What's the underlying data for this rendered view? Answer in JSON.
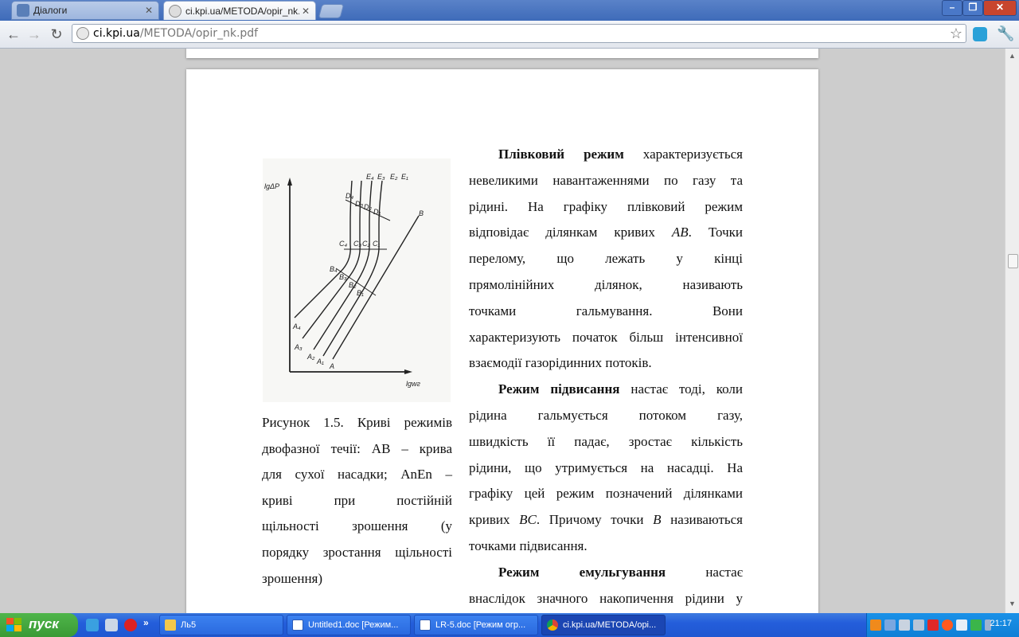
{
  "browser": {
    "tabs": [
      {
        "title": "Діалоги",
        "active": false
      },
      {
        "title": "ci.kpi.ua/METODA/opir_nk.pdf",
        "active": true
      }
    ],
    "url_host": "ci.kpi.ua",
    "url_path": "/METODA/opir_nk.pdf"
  },
  "figure": {
    "y_axis_label": "lgΔP",
    "x_axis_label": "lgwг",
    "labels": {
      "E4": "E₄",
      "E3": "E₃",
      "E2": "E₂",
      "E1": "E₁",
      "D4": "D₄",
      "D3": "D₃",
      "D2": "D₂",
      "D1": "D₁",
      "C4": "C₄",
      "C3": "C₃",
      "C2": "C₂",
      "C1": "C₁",
      "B4": "B₄",
      "B3": "B₃",
      "B2": "B₂",
      "B1": "B₁",
      "A4": "A₄",
      "A3": "A₃",
      "A2": "A₂",
      "A1": "A₁",
      "A": "A",
      "B": "B"
    }
  },
  "caption": [
    "Рисунок 1.5. Криві режимів",
    "двофазної течії: AB – крива",
    "для сухої насадки; AnEn –",
    "криві при постійній",
    "щільності зрошення (у",
    "порядку зростання щільності",
    "зрошення)"
  ],
  "text": {
    "p1_bold": "Плівковий режим",
    "p1_l1": " характеризується",
    "p1_l2": "невеликими навантаженнями по газу та",
    "p1_l3": "рідині. На графіку плівковий режим",
    "p1_l4a": "відповідає ділянкам кривих ",
    "p1_l4i": "AB",
    "p1_l4b": ". Точки",
    "p1_l5": "перелому, що лежать у кінці",
    "p1_l6": "прямолінійних ділянок, називають",
    "p1_l7": "точками гальмування. Вони",
    "p1_l8": "характеризують початок більш інтенсивної",
    "p1_l9": "взаємодії газорідинних потоків.",
    "p2_bold": "Режим підвисання",
    "p2_l1": " настає тоді, коли",
    "p2_l2": "рідина гальмується потоком газу,",
    "p2_l3": "швидкість її падає, зростає кількість",
    "p2_l4": "рідини, що утримується на насадці. На",
    "p2_l5": "графіку цей режим позначений ділянками",
    "p2_l6a": "кривих ",
    "p2_l6i": "BC",
    "p2_l6b": ". Причому точки ",
    "p2_l6i2": "B",
    "p2_l6c": " називаються",
    "p2_l7": "точками підвисання.",
    "p3_bold": "Режим емульгування",
    "p3_l1": " настає",
    "p3_l2": "внаслідок значного накопичення рідини у"
  },
  "taskbar": {
    "start": "пуск",
    "buttons": [
      {
        "label": "Ль5"
      },
      {
        "label": "Untitled1.doc [Режим..."
      },
      {
        "label": "LR-5.doc [Режим огр..."
      },
      {
        "label": "ci.kpi.ua/METODA/opi..."
      }
    ],
    "clock": "21:17"
  }
}
